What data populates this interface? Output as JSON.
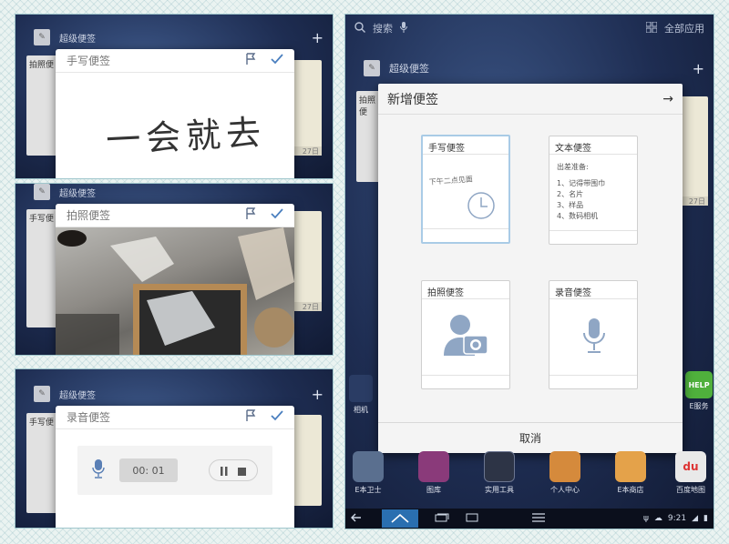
{
  "widget": {
    "title": "超级便签"
  },
  "notes": {
    "handwritten": {
      "title": "手写便签",
      "content": "一会就去"
    },
    "photo": {
      "title": "拍照便签"
    },
    "voice": {
      "title": "录音便签",
      "timer": "00: 01"
    },
    "text": {
      "title": "文本便签",
      "lines": [
        "出差准备:",
        "1、记得带围巾",
        "2、名片",
        "3、样品",
        "4、数码相机"
      ]
    }
  },
  "bg_cards": {
    "top_left": "拍照便",
    "mid_left": "手写便",
    "bottom_left": "手写便",
    "footer_date": "27日"
  },
  "topbar": {
    "search": "搜索",
    "all_apps": "全部应用"
  },
  "new_note_dialog": {
    "title": "新增便签",
    "preview_handwriting": "下午二点见面",
    "cancel": "取消"
  },
  "dock": [
    {
      "label": "E本卫士",
      "color": "#5a6f8f"
    },
    {
      "label": "图库",
      "color": "#8a3a7a"
    },
    {
      "label": "实用工具",
      "color": "#2d3446"
    },
    {
      "label": "个人中心",
      "color": "#d58a3c"
    },
    {
      "label": "E本商店",
      "color": "#e4a24a"
    },
    {
      "label": "百度地图",
      "color": "#e0e0e0"
    }
  ],
  "side_apps": {
    "left_partial": "相机",
    "right_badge": "HELP",
    "right_partial": "E服务"
  },
  "status": {
    "time": "9:21"
  },
  "colors": {
    "accent": "#3a7bc8",
    "selected_border": "#a9cbe6"
  }
}
